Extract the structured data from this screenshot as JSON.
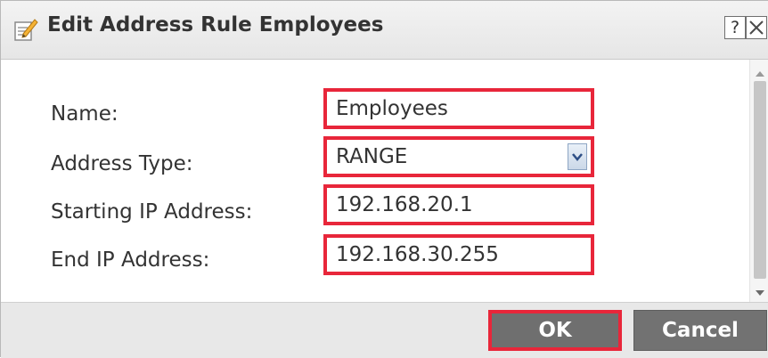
{
  "dialog": {
    "title": "Edit Address Rule Employees",
    "title_icon": "edit-icon",
    "help_label": "?",
    "close_icon": "close-icon"
  },
  "form": {
    "name_label": "Name:",
    "name_value": "Employees",
    "type_label": "Address Type:",
    "type_value": "RANGE",
    "start_label": "Starting IP Address:",
    "start_value": "192.168.20.1",
    "end_label": "End IP Address:",
    "end_value": "192.168.30.255"
  },
  "buttons": {
    "ok_label": "OK",
    "cancel_label": "Cancel"
  },
  "colors": {
    "highlight": "#e8263a",
    "button_gray": "#6f6f6f",
    "text": "#333333"
  }
}
